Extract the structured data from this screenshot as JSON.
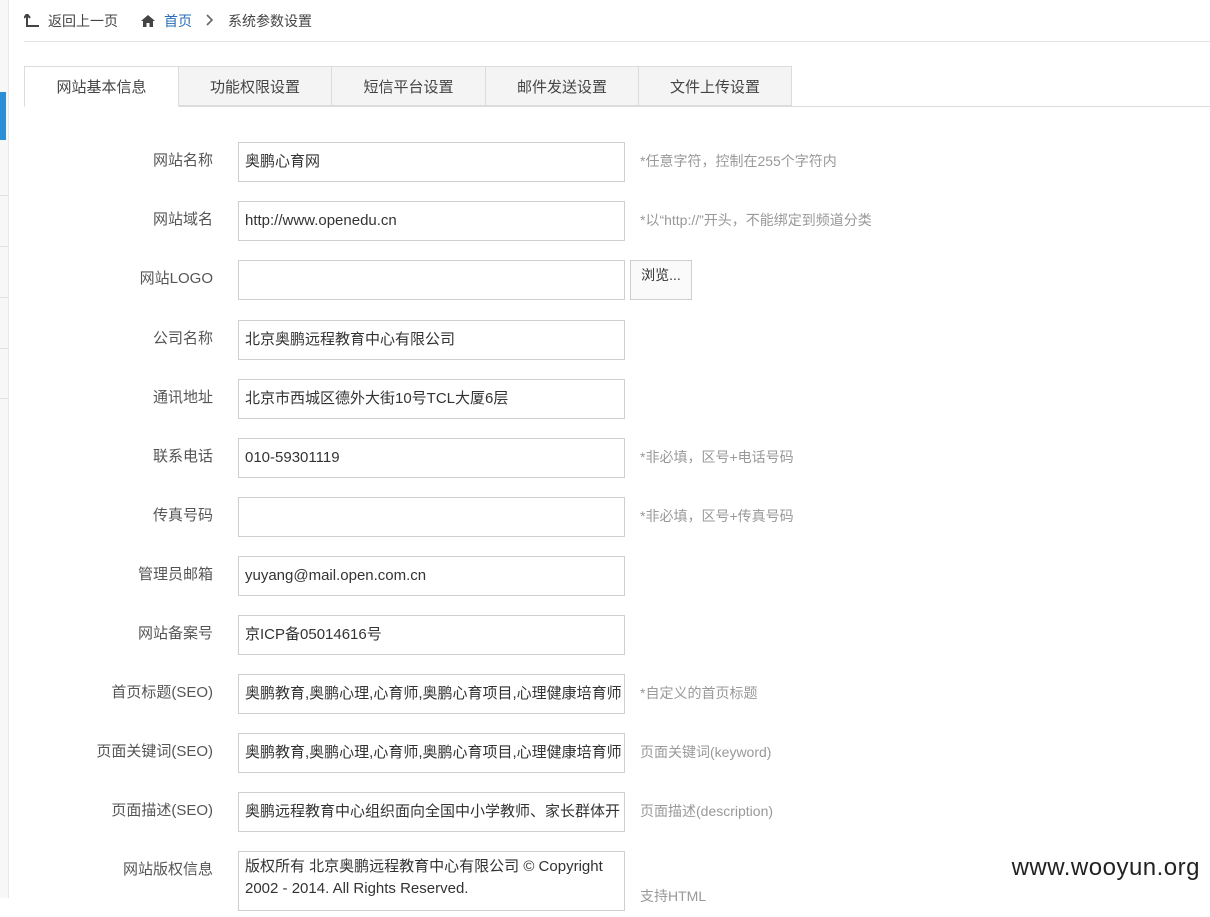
{
  "nav": {
    "back_label": "返回上一页",
    "home_label": "首页",
    "current_label": "系统参数设置"
  },
  "tabs": [
    {
      "label": "网站基本信息",
      "active": true
    },
    {
      "label": "功能权限设置",
      "active": false
    },
    {
      "label": "短信平台设置",
      "active": false
    },
    {
      "label": "邮件发送设置",
      "active": false
    },
    {
      "label": "文件上传设置",
      "active": false
    }
  ],
  "form": {
    "site_name": {
      "label": "网站名称",
      "value": "奥鹏心育网",
      "hint": "*任意字符，控制在255个字符内"
    },
    "site_domain": {
      "label": "网站域名",
      "value": "http://www.openedu.cn",
      "hint": "*以“http://”开头，不能绑定到频道分类"
    },
    "site_logo": {
      "label": "网站LOGO",
      "value": "",
      "browse_label": "浏览..."
    },
    "company_name": {
      "label": "公司名称",
      "value": "北京奥鹏远程教育中心有限公司"
    },
    "address": {
      "label": "通讯地址",
      "value": "北京市西城区德外大街10号TCL大厦6层"
    },
    "phone": {
      "label": "联系电话",
      "value": "010-59301119",
      "hint": "*非必填，区号+电话号码"
    },
    "fax": {
      "label": "传真号码",
      "value": "",
      "hint": "*非必填，区号+传真号码"
    },
    "admin_email": {
      "label": "管理员邮箱",
      "value": "yuyang@mail.open.com.cn"
    },
    "icp": {
      "label": "网站备案号",
      "value": "京ICP备05014616号"
    },
    "seo_title": {
      "label": "首页标题(SEO)",
      "value": "奥鹏教育,奥鹏心理,心育师,奥鹏心育项目,心理健康培育师",
      "hint": "*自定义的首页标题"
    },
    "seo_keywords": {
      "label": "页面关键词(SEO)",
      "value": "奥鹏教育,奥鹏心理,心育师,奥鹏心育项目,心理健康培育师",
      "hint": "页面关键词(keyword)"
    },
    "seo_description": {
      "label": "页面描述(SEO)",
      "value": "奥鹏远程教育中心组织面向全国中小学教师、家长群体开",
      "hint": "页面描述(description)"
    },
    "copyright": {
      "label": "网站版权信息",
      "value": "版权所有 北京奥鹏远程教育中心有限公司 © Copyright 2002 - 2014. All Rights Reserved.",
      "hint": "支持HTML"
    }
  },
  "watermark": "www.wooyun.org",
  "colors": {
    "link": "#2a6db6",
    "hint": "#999999",
    "border": "#cfcfcf",
    "accent": "#2a8fd6"
  }
}
